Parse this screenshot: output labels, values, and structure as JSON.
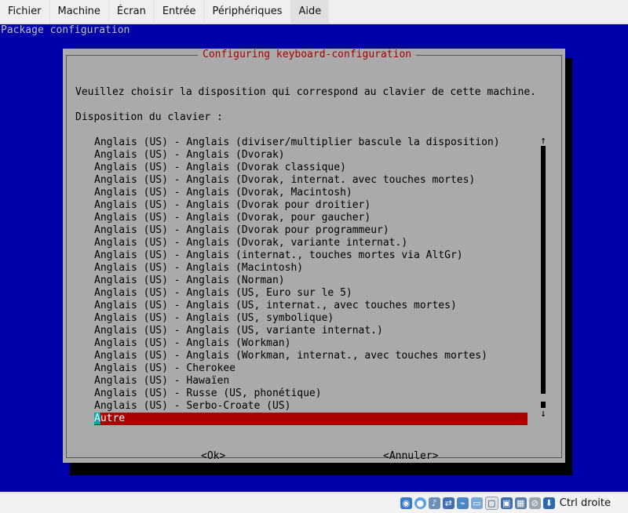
{
  "menubar": {
    "items": [
      "Fichier",
      "Machine",
      "Écran",
      "Entrée",
      "Périphériques",
      "Aide"
    ]
  },
  "console": {
    "title_line": "Package configuration",
    "dialog": {
      "title": "Configuring keyboard-configuration",
      "prompt": "Veuillez choisir la disposition qui correspond au clavier de cette machine.",
      "label": "Disposition du clavier :",
      "options": [
        "Anglais (US) - Anglais (diviser/multiplier bascule la disposition)",
        "Anglais (US) - Anglais (Dvorak)",
        "Anglais (US) - Anglais (Dvorak classique)",
        "Anglais (US) - Anglais (Dvorak, internat. avec touches mortes)",
        "Anglais (US) - Anglais (Dvorak, Macintosh)",
        "Anglais (US) - Anglais (Dvorak pour droitier)",
        "Anglais (US) - Anglais (Dvorak, pour gaucher)",
        "Anglais (US) - Anglais (Dvorak pour programmeur)",
        "Anglais (US) - Anglais (Dvorak, variante internat.)",
        "Anglais (US) - Anglais (internat., touches mortes via AltGr)",
        "Anglais (US) - Anglais (Macintosh)",
        "Anglais (US) - Anglais (Norman)",
        "Anglais (US) - Anglais (US, Euro sur le 5)",
        "Anglais (US) - Anglais (US, internat., avec touches mortes)",
        "Anglais (US) - Anglais (US, symbolique)",
        "Anglais (US) - Anglais (US, variante internat.)",
        "Anglais (US) - Anglais (Workman)",
        "Anglais (US) - Anglais (Workman, internat., avec touches mortes)",
        "Anglais (US) - Cherokee",
        "Anglais (US) - Hawaïen",
        "Anglais (US) - Russe (US, phonétique)",
        "Anglais (US) - Serbo-Croate (US)"
      ],
      "selected_first_char": "A",
      "selected_rest": "utre",
      "ok_label": "<Ok>",
      "cancel_label": "<Annuler>"
    }
  },
  "statusbar": {
    "host_key_label": "Ctrl droite",
    "icons": [
      "hard-disk-icon",
      "optical-drive-icon",
      "audio-icon",
      "network-icon",
      "usb-icon",
      "shared-folder-icon",
      "display-icon",
      "recording-icon",
      "cpu-icon",
      "mouse-integration-icon",
      "keyboard-capture-icon"
    ]
  }
}
